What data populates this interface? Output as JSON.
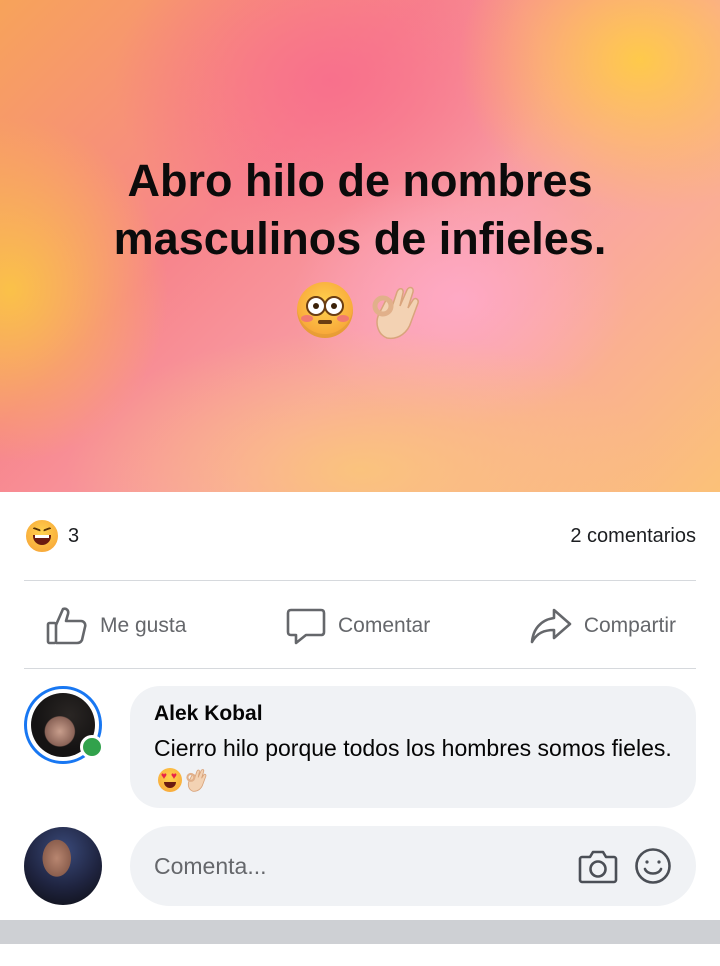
{
  "post": {
    "text": "Abro hilo de nombres masculinos de infieles.",
    "emojis": [
      "flushed-face",
      "ok-hand"
    ]
  },
  "stats": {
    "reaction_icon": "laughing-face",
    "reaction_count": "3",
    "comments_count": "2 comentarios"
  },
  "actions": {
    "like_label": "Me gusta",
    "comment_label": "Comentar",
    "share_label": "Compartir"
  },
  "comment": {
    "author": "Alek Kobal",
    "text": "Cierro hilo porque todos los hombres somos fieles.",
    "emojis": [
      "heart-eyes-face",
      "ok-hand"
    ],
    "online": true
  },
  "composer": {
    "placeholder": "Comenta..."
  },
  "colors": {
    "accent": "#1877f2",
    "online": "#31a24c",
    "secondary_text": "#65676b",
    "bubble_bg": "#f0f2f5"
  }
}
